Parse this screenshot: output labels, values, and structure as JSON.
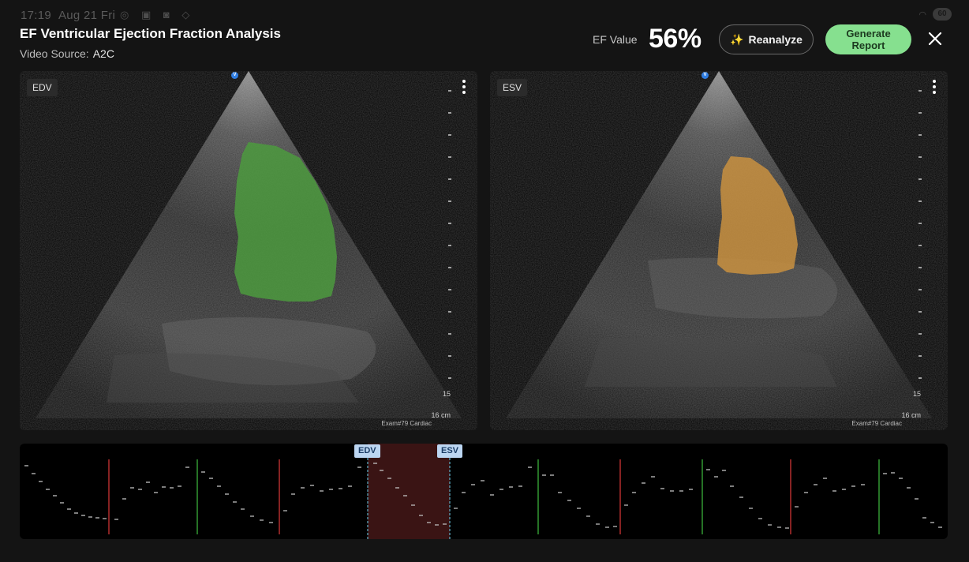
{
  "status_bar": {
    "time": "17:19",
    "date": "Aug 21 Fri",
    "battery": "60"
  },
  "header": {
    "title": "EF Ventricular Ejection Fraction Analysis",
    "video_source_label": "Video Source:",
    "video_source_value": "A2C",
    "ef_label": "EF Value",
    "ef_value": "56%",
    "reanalyze_label": "Reanalyze",
    "generate_report_label": "Generate Report"
  },
  "panels": [
    {
      "tag": "EDV",
      "depth_mark": "15",
      "depth_unit": "16 cm",
      "exam": "Exam#79  Cardiac",
      "mask_color": "#4c9a3e"
    },
    {
      "tag": "ESV",
      "depth_mark": "15",
      "depth_unit": "16 cm",
      "exam": "Exam#79  Cardiac",
      "mask_color": "#c9913f"
    }
  ],
  "timeline": {
    "edv_label": "EDV",
    "esv_label": "ESV",
    "colors": {
      "edv_line": "#3fbf3f",
      "esv_line": "#e03a3a",
      "selection": "#3a1414",
      "dash": "#c8c8c8"
    }
  },
  "colors": {
    "accent_green": "#86e08f",
    "background": "#141414",
    "probe_marker": "#2f7de1"
  }
}
